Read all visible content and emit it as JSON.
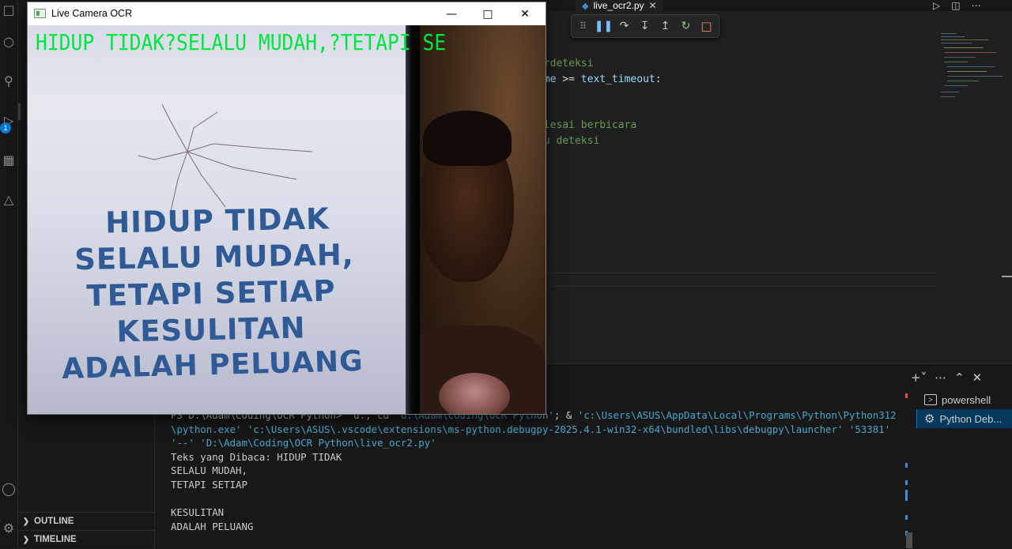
{
  "editor": {
    "tab_label": "live_ocr2.py",
    "code_lines": [
      {
        "comment": "erdeteksi"
      },
      {
        "prefix": "ime",
        "op": " >= ",
        "var": "text_timeout",
        "end": ":"
      },
      {
        "comment": "elesai berbicara"
      },
      {
        "comment": "tu deteksi"
      }
    ]
  },
  "debug_toolbar": {
    "icons": [
      "grip-icon",
      "pause-icon",
      "step-over-icon",
      "step-into-icon",
      "step-out-icon",
      "restart-icon",
      "stop-icon"
    ]
  },
  "sidebar": {
    "sections": [
      {
        "label": "OUTLINE"
      },
      {
        "label": "TIMELINE"
      }
    ]
  },
  "activity_bar": {
    "badge": "1"
  },
  "camera_window": {
    "title": "Live Camera OCR",
    "ocr_overlay": "HIDUP TIDAK?SELALU MUDAH,?TETAPI SE",
    "paper_lines": [
      "HIDUP TIDAK",
      "SELALU MUDAH,",
      "TETAPI SETIAP",
      "KESULITAN",
      "ADALAH PELUANG"
    ]
  },
  "terminal": {
    "prompt": "PS D:\\Adam\\Coding\\OCR Python> ",
    "cmd_part1": " d:; cd ",
    "cmd_path": "'d:\\Adam\\Coding\\OCR Python'",
    "cmd_part2": "; & ",
    "cmd_exe1": "'c:\\Users\\ASUS\\AppData\\Local\\Programs\\Python\\Python312",
    "cmd_exe2": "\\python.exe' 'c:\\Users\\ASUS\\.vscode\\extensions\\ms-python.debugpy-2025.4.1-win32-x64\\bundled\\libs\\debugpy\\launcher' '53381'",
    "cmd_exe3": "'--' 'D:\\Adam\\Coding\\OCR Python\\live_ocr2.py'",
    "output": [
      "Teks yang Dibaca: HIDUP TIDAK",
      "SELALU MUDAH,",
      "TETAPI SETIAP",
      "",
      "KESULITAN",
      "ADALAH PELUANG"
    ],
    "sessions": [
      {
        "label": "powershell",
        "icon": "terminal-icon"
      },
      {
        "label": "Python Deb...",
        "icon": "debug-gear-icon"
      }
    ]
  },
  "colors": {
    "ocr_text": "#00e640",
    "accent": "#0078d4",
    "paper_text": "#2f5a96"
  }
}
